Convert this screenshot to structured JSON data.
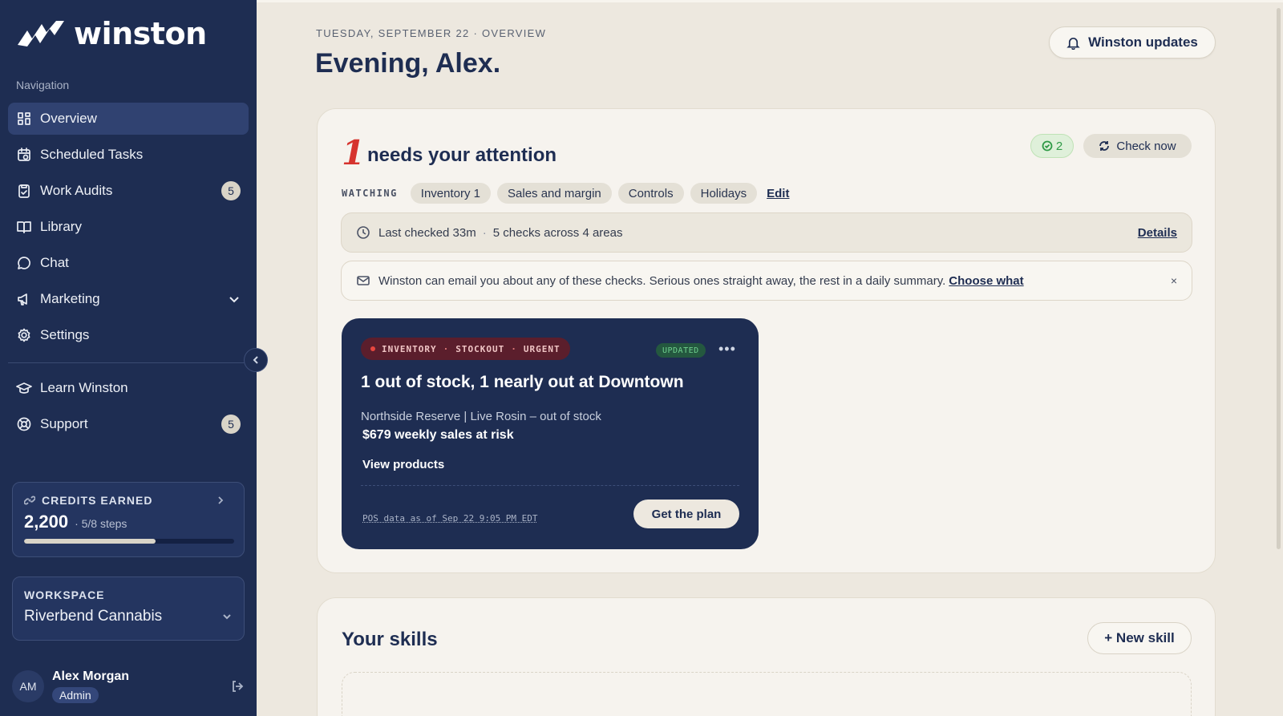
{
  "brand": {
    "name": "winston"
  },
  "sidebar": {
    "heading": "Navigation",
    "items": [
      {
        "label": "Overview",
        "icon": "grid-icon",
        "active": true
      },
      {
        "label": "Scheduled Tasks",
        "icon": "calendar-clock-icon"
      },
      {
        "label": "Work Audits",
        "icon": "clipboard-icon",
        "badge": "5"
      },
      {
        "label": "Library",
        "icon": "book-icon"
      },
      {
        "label": "Chat",
        "icon": "chat-bubble-icon"
      },
      {
        "label": "Marketing",
        "icon": "megaphone-icon",
        "expandable": true
      },
      {
        "label": "Settings",
        "icon": "gear-icon"
      }
    ],
    "secondary": [
      {
        "label": "Learn Winston",
        "icon": "graduation-cap-icon"
      },
      {
        "label": "Support",
        "icon": "lifebuoy-icon",
        "badge": "5"
      }
    ],
    "credits": {
      "label": "CREDITS EARNED",
      "value": "2,200",
      "steps": "· 5/8 steps",
      "progress": 0.625
    },
    "workspace": {
      "label": "WORKSPACE",
      "name": "Riverbend Cannabis"
    },
    "user": {
      "initials": "AM",
      "name": "Alex Morgan",
      "role": "Admin"
    }
  },
  "header": {
    "date_line": "TUESDAY, SEPTEMBER 22 · OVERVIEW",
    "greeting": "Evening, Alex.",
    "updates_button": "Winston updates"
  },
  "attention": {
    "count": "1",
    "title": "needs your attention",
    "ok_count": "2",
    "check_button": "Check now",
    "watching_label": "WATCHING",
    "chips": [
      "Inventory  1",
      "Sales and margin",
      "Controls",
      "Holidays"
    ],
    "edit_label": "Edit",
    "last_checked": "Last checked 33m",
    "checks_summary": "5 checks across 4 areas",
    "details_label": "Details",
    "email_notice": "Winston can email you about any of these checks. Serious ones straight away, the rest in a daily summary.",
    "choose_label": "Choose what",
    "close_label": "×"
  },
  "issue": {
    "tag_parts": [
      "INVENTORY",
      "STOCKOUT",
      "URGENT"
    ],
    "updated_label": "UPDATED",
    "more_label": "•••",
    "title": "1 out of stock, 1 nearly out at Downtown",
    "subtitle": "Northside Reserve | Live Rosin – out of stock",
    "risk": "$679 weekly sales at risk",
    "link": "View products",
    "pos_note": "POS data as of Sep 22 9:05 PM EDT",
    "plan_button": "Get the plan"
  },
  "skills": {
    "title": "Your skills",
    "new_button": "+ New skill"
  },
  "colors": {
    "sidebar": "#1e2d52",
    "background": "#ede8df",
    "urgent": "#d6332e",
    "ok": "#2f9a46"
  }
}
